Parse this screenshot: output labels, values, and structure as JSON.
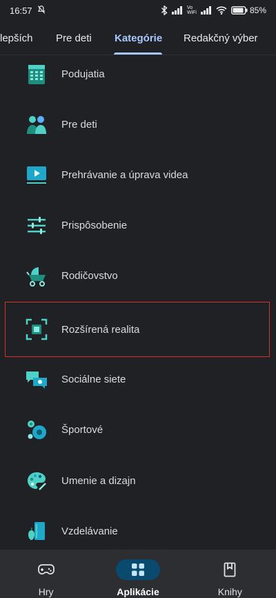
{
  "status_bar": {
    "time": "16:57",
    "vowifi_top": "Vo",
    "vowifi_bottom": "WiFi",
    "battery": "85%"
  },
  "tabs": [
    {
      "label": "lepších",
      "active": false
    },
    {
      "label": "Pre deti",
      "active": false
    },
    {
      "label": "Kategórie",
      "active": true
    },
    {
      "label": "Redakčný výber",
      "active": false
    }
  ],
  "categories": [
    {
      "label": "Podujatia",
      "icon": "calendar-icon"
    },
    {
      "label": "Pre deti",
      "icon": "kids-icon"
    },
    {
      "label": "Prehrávanie a úprava videa",
      "icon": "video-play-icon"
    },
    {
      "label": "Prispôsobenie",
      "icon": "sliders-icon"
    },
    {
      "label": "Rodičovstvo",
      "icon": "stroller-icon"
    },
    {
      "label": "Rozšírená realita",
      "icon": "augmented-reality-icon"
    },
    {
      "label": "Sociálne siete",
      "icon": "chat-bubbles-icon"
    },
    {
      "label": "Športové",
      "icon": "sports-ball-icon"
    },
    {
      "label": "Umenie a dizajn",
      "icon": "palette-icon"
    },
    {
      "label": "Vzdelávanie",
      "icon": "education-book-icon"
    }
  ],
  "bottom_nav": [
    {
      "label": "Hry",
      "icon": "gamepad-icon",
      "active": false
    },
    {
      "label": "Aplikácie",
      "icon": "apps-grid-icon",
      "active": true
    },
    {
      "label": "Knihy",
      "icon": "bookmark-book-icon",
      "active": false
    }
  ],
  "colors": {
    "background": "#202124",
    "accent": "#a8c7fa",
    "icon_teal": "#4fd1c5",
    "highlight_border": "#d93025",
    "nav_active_pill": "#0b4a6f"
  }
}
